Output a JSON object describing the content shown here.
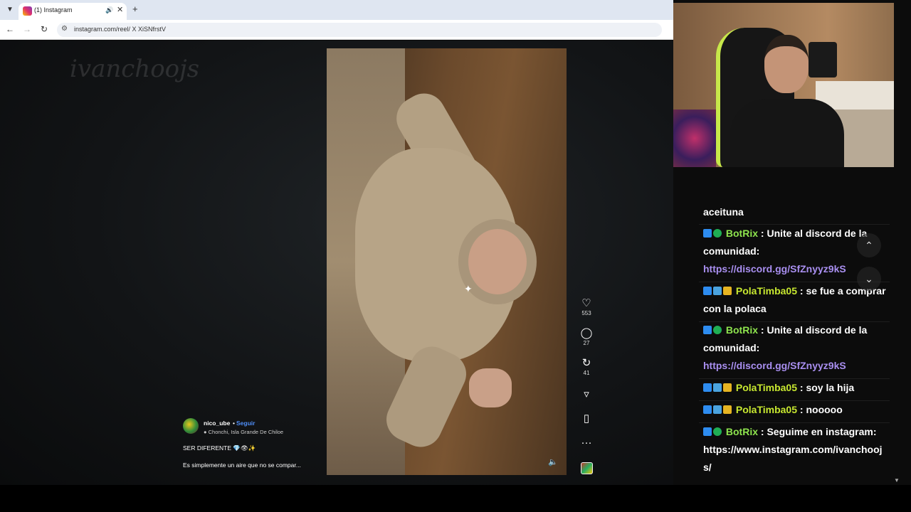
{
  "browser": {
    "tab_title": "(1) Instagram",
    "tab_audio_icon": "speaker-icon",
    "tab_close": "✕",
    "new_tab": "+",
    "url": "instagram.com/reel/ X XiSNfrstV"
  },
  "post": {
    "username": "nico_ube",
    "dot": "•",
    "follow_label": "Seguir",
    "location": "Chonchi, Isla Grande De Chiloe",
    "caption_line1": "SER DIFERENTE 💎👁✨",
    "caption_line2": "Es simplemente un aire que no se compar..."
  },
  "actions": {
    "likes": "553",
    "comments": "27",
    "reposts": "41"
  },
  "watermark": "ivanchoojs",
  "chat": {
    "messages": [
      {
        "user": "",
        "text": "aceituna"
      },
      {
        "user": "BotRix",
        "text": "Unite al discord de la comunidad:",
        "link": "https://discord.gg/SfZnyyz9kS"
      },
      {
        "user": "PolaTimba05",
        "text": "se fue a comprar con la polaca"
      },
      {
        "user": "BotRix",
        "text": "Unite al discord de la comunidad:",
        "link": "https://discord.gg/SfZnyyz9kS"
      },
      {
        "user": "PolaTimba05",
        "text": "soy la hija"
      },
      {
        "user": "PolaTimba05",
        "text": "nooooo"
      },
      {
        "user": "BotRix",
        "text": "Seguime en instagram:",
        "link_plain": "https://www.instagram.com/ivanchoojs/"
      }
    ],
    "separator": " : "
  },
  "colors": {
    "botrix_name": "#8ee44e",
    "pola_name": "#c8e830",
    "link": "#a98ff0",
    "follow": "#4f8ef7"
  }
}
